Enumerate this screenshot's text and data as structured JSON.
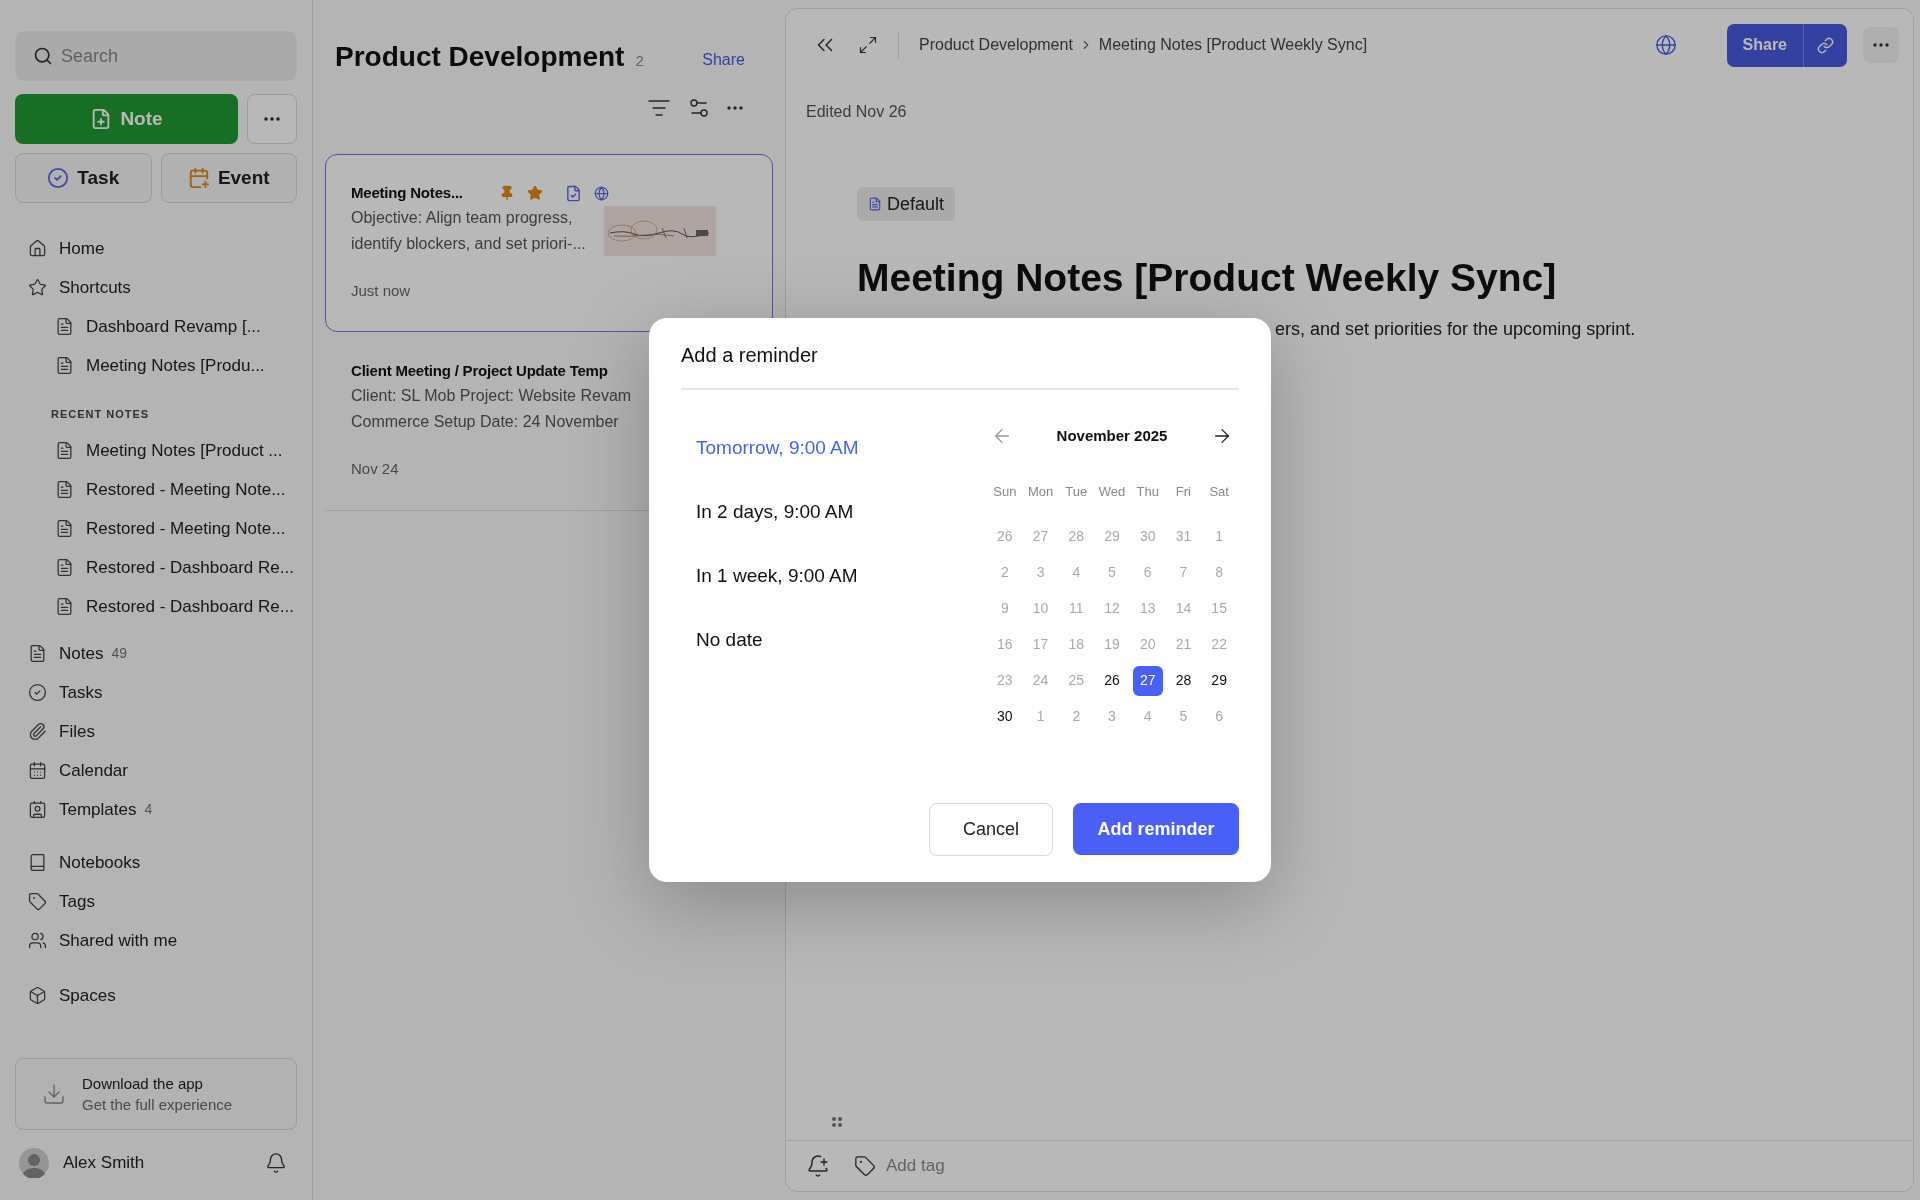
{
  "sidebar": {
    "search": {
      "placeholder": "Search"
    },
    "new_note": "Note",
    "task": "Task",
    "event": "Event",
    "nav": [
      {
        "label": "Home"
      },
      {
        "label": "Shortcuts",
        "children": [
          {
            "label": "Dashboard Revamp [..."
          },
          {
            "label": "Meeting Notes [Produ..."
          }
        ]
      }
    ],
    "recent_heading": "RECENT NOTES",
    "recent": [
      {
        "label": "Meeting Notes [Product ..."
      },
      {
        "label": "Restored - Meeting Note..."
      },
      {
        "label": "Restored - Meeting Note..."
      },
      {
        "label": "Restored - Dashboard Re..."
      },
      {
        "label": "Restored - Dashboard Re..."
      }
    ],
    "library": [
      {
        "label": "Notes",
        "count": "49"
      },
      {
        "label": "Tasks"
      },
      {
        "label": "Files"
      },
      {
        "label": "Calendar"
      },
      {
        "label": "Templates",
        "count": "4"
      }
    ],
    "collections": [
      {
        "label": "Notebooks"
      },
      {
        "label": "Tags"
      },
      {
        "label": "Shared with me"
      }
    ],
    "spaces": "Spaces",
    "download": {
      "title": "Download the app",
      "subtitle": "Get the full experience"
    },
    "user": {
      "name": "Alex Smith"
    }
  },
  "note_list": {
    "title": "Product Development",
    "count": "2",
    "share": "Share",
    "notes": [
      {
        "title": "Meeting Notes...",
        "preview": [
          "Objective: Align team progress,",
          "identify blockers, and set priori-..."
        ],
        "time": "Just now",
        "selected": true,
        "pinned": true,
        "starred": true,
        "template": true,
        "published": true,
        "thumbnail": {
          "kind": "picture"
        }
      },
      {
        "title": "Client Meeting / Project Update Temp",
        "preview": [
          "Client: SL Mob Project: Website Revam",
          "Commerce Setup Date: 24 November"
        ],
        "time": "Nov 24",
        "selected": false,
        "pinned": false,
        "starred": false,
        "template": false,
        "published": false
      }
    ]
  },
  "editor": {
    "breadcrumb": [
      "Product Development",
      "Meeting Notes [Product Weekly Sync]"
    ],
    "share": "Share",
    "edited": "Edited Nov 26",
    "notebook": "Default",
    "title": "Meeting Notes [Product Weekly Sync]",
    "body": "ers, and set priorities for the upcoming sprint.",
    "add_tag": "Add tag"
  },
  "dialog": {
    "title": "Add a reminder",
    "options": [
      {
        "label": "Tomorrow, 9:00 AM",
        "selected": true
      },
      {
        "label": "In 2 days, 9:00 AM",
        "selected": false
      },
      {
        "label": "In 1 week, 9:00 AM",
        "selected": false
      },
      {
        "label": "No date",
        "selected": false
      }
    ],
    "month": "November 2025",
    "weekdays": [
      "Sun",
      "Mon",
      "Tue",
      "Wed",
      "Thu",
      "Fri",
      "Sat"
    ],
    "weeks": [
      [
        {
          "day": "26",
          "disabled": true,
          "selected": false
        },
        {
          "day": "27",
          "disabled": true,
          "selected": false
        },
        {
          "day": "28",
          "disabled": true,
          "selected": false
        },
        {
          "day": "29",
          "disabled": true,
          "selected": false
        },
        {
          "day": "30",
          "disabled": true,
          "selected": false
        },
        {
          "day": "31",
          "disabled": true,
          "selected": false
        },
        {
          "day": "1",
          "disabled": true,
          "selected": false
        }
      ],
      [
        {
          "day": "2",
          "disabled": true,
          "selected": false
        },
        {
          "day": "3",
          "disabled": true,
          "selected": false
        },
        {
          "day": "4",
          "disabled": true,
          "selected": false
        },
        {
          "day": "5",
          "disabled": true,
          "selected": false
        },
        {
          "day": "6",
          "disabled": true,
          "selected": false
        },
        {
          "day": "7",
          "disabled": true,
          "selected": false
        },
        {
          "day": "8",
          "disabled": true,
          "selected": false
        }
      ],
      [
        {
          "day": "9",
          "disabled": true,
          "selected": false
        },
        {
          "day": "10",
          "disabled": true,
          "selected": false
        },
        {
          "day": "11",
          "disabled": true,
          "selected": false
        },
        {
          "day": "12",
          "disabled": true,
          "selected": false
        },
        {
          "day": "13",
          "disabled": true,
          "selected": false
        },
        {
          "day": "14",
          "disabled": true,
          "selected": false
        },
        {
          "day": "15",
          "disabled": true,
          "selected": false
        }
      ],
      [
        {
          "day": "16",
          "disabled": true,
          "selected": false
        },
        {
          "day": "17",
          "disabled": true,
          "selected": false
        },
        {
          "day": "18",
          "disabled": true,
          "selected": false
        },
        {
          "day": "19",
          "disabled": true,
          "selected": false
        },
        {
          "day": "20",
          "disabled": true,
          "selected": false
        },
        {
          "day": "21",
          "disabled": true,
          "selected": false
        },
        {
          "day": "22",
          "disabled": true,
          "selected": false
        }
      ],
      [
        {
          "day": "23",
          "disabled": true,
          "selected": false
        },
        {
          "day": "24",
          "disabled": true,
          "selected": false
        },
        {
          "day": "25",
          "disabled": true,
          "selected": false
        },
        {
          "day": "26",
          "disabled": false,
          "selected": false
        },
        {
          "day": "27",
          "disabled": false,
          "selected": true
        },
        {
          "day": "28",
          "disabled": false,
          "selected": false
        },
        {
          "day": "29",
          "disabled": false,
          "selected": false
        }
      ],
      [
        {
          "day": "30",
          "disabled": false,
          "selected": false
        },
        {
          "day": "1",
          "disabled": true,
          "selected": false
        },
        {
          "day": "2",
          "disabled": true,
          "selected": false
        },
        {
          "day": "3",
          "disabled": true,
          "selected": false
        },
        {
          "day": "4",
          "disabled": true,
          "selected": false
        },
        {
          "day": "5",
          "disabled": true,
          "selected": false
        },
        {
          "day": "6",
          "disabled": true,
          "selected": false
        }
      ]
    ],
    "cancel": "Cancel",
    "confirm": "Add reminder"
  }
}
